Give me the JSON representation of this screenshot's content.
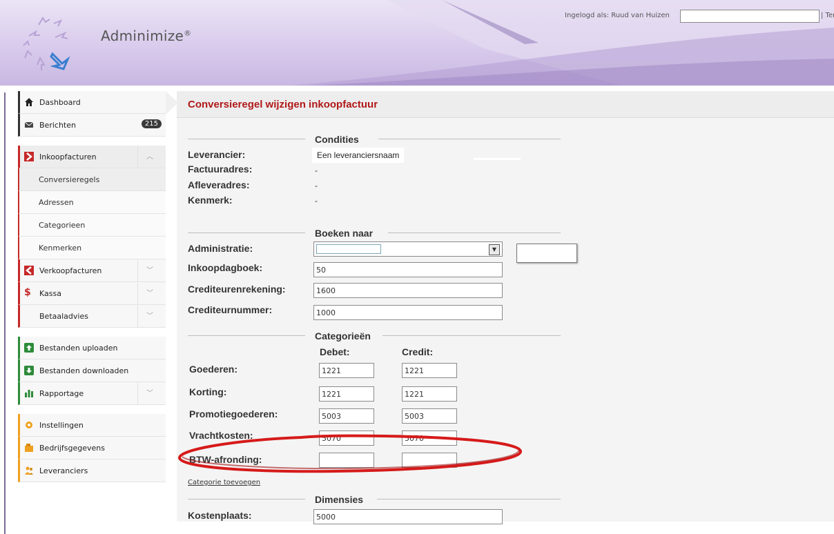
{
  "header": {
    "app_name": "Adminimize",
    "trademark": "®",
    "login_label": "Ingelogd als: Ruud van Huizen",
    "login_extra": "| Ter"
  },
  "sidebar": {
    "items": [
      {
        "label": "Dashboard",
        "icon": "home-icon"
      },
      {
        "label": "Berichten",
        "icon": "envelope-icon",
        "badge": "215"
      },
      {
        "label": "Inkoopfacturen",
        "icon": "arrow-right-red-icon"
      },
      {
        "label": "Conversieregels"
      },
      {
        "label": "Adressen"
      },
      {
        "label": "Categorieen"
      },
      {
        "label": "Kenmerken"
      },
      {
        "label": "Verkoopfacturen",
        "icon": "arrow-left-red-icon"
      },
      {
        "label": "Kassa",
        "icon": "dollar-icon"
      },
      {
        "label": "Betaaladvies"
      },
      {
        "label": "Bestanden uploaden",
        "icon": "upload-icon"
      },
      {
        "label": "Bestanden downloaden",
        "icon": "download-icon"
      },
      {
        "label": "Rapportage",
        "icon": "bar-chart-icon"
      },
      {
        "label": "Instellingen",
        "icon": "gear-icon"
      },
      {
        "label": "Bedrijfsgegevens",
        "icon": "building-icon"
      },
      {
        "label": "Leveranciers",
        "icon": "people-icon"
      }
    ]
  },
  "page": {
    "title": "Conversieregel wijzigen inkoopfactuur"
  },
  "condities": {
    "legend": "Condities",
    "leverancier_label": "Leverancier:",
    "leverancier_value": "Een leveranciersnaam",
    "factuuradres_label": "Factuuradres:",
    "factuuradres_value": "-",
    "afleveradres_label": "Afleveradres:",
    "afleveradres_value": "-",
    "kenmerk_label": "Kenmerk:",
    "kenmerk_value": "-"
  },
  "boeken": {
    "legend": "Boeken naar",
    "administratie_label": "Administratie:",
    "administratie_value": "",
    "inkoopdagboek_label": "Inkoopdagboek:",
    "inkoopdagboek_value": "50",
    "crediteurenrekening_label": "Crediteurenrekening:",
    "crediteurenrekening_value": "1600",
    "crediteurnummer_label": "Crediteurnummer:",
    "crediteurnummer_value": "1000"
  },
  "categorieen": {
    "legend": "Categorieën",
    "debet_header": "Debet:",
    "credit_header": "Credit:",
    "rows": [
      {
        "label": "Goederen:",
        "debet": "1221",
        "credit": "1221"
      },
      {
        "label": "Korting:",
        "debet": "1221",
        "credit": "1221"
      },
      {
        "label": "Promotiegoederen:",
        "debet": "5003",
        "credit": "5003"
      },
      {
        "label": "Vrachtkosten:",
        "debet": "5070",
        "credit": "5070"
      },
      {
        "label": "BTW-afronding:",
        "debet": "",
        "credit": ""
      }
    ],
    "add_link": "Categorie toevoegen"
  },
  "dimensies": {
    "legend": "Dimensies",
    "kostenplaats_label": "Kostenplaats:",
    "kostenplaats_value": "5000"
  },
  "colors": {
    "accent_red": "#b01818",
    "highlight_ellipse": "#d61a1a",
    "header_purple": "#d8cbec"
  }
}
